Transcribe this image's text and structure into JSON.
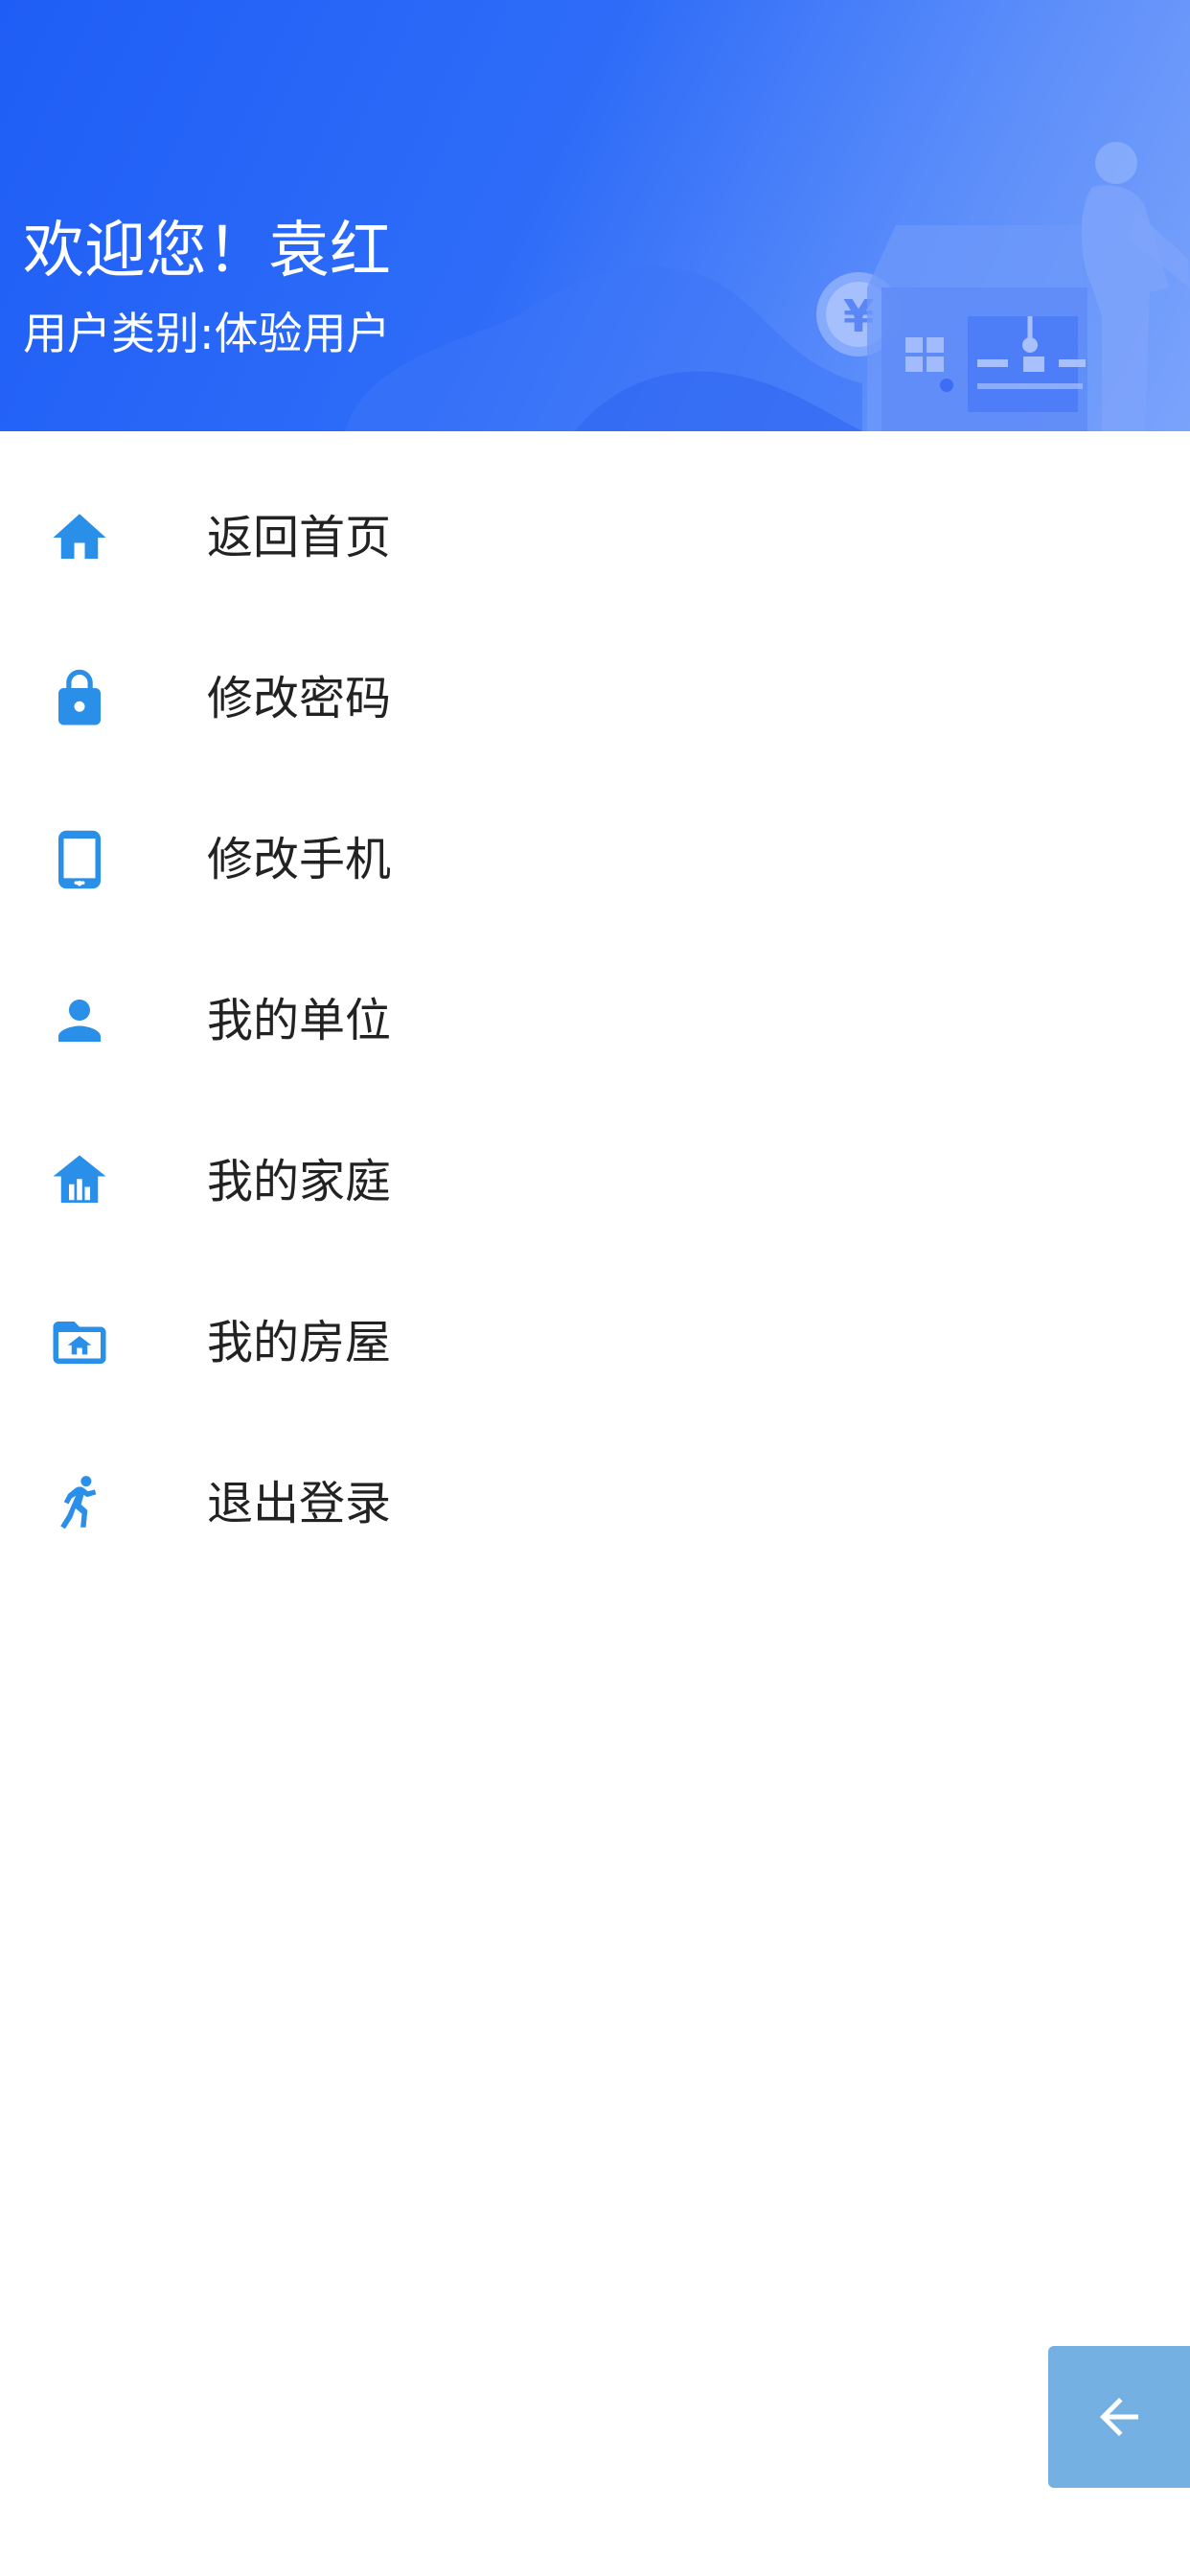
{
  "header": {
    "welcome": "欢迎您！袁红",
    "user_type": "用户类别:体验用户",
    "currency_symbol": "¥"
  },
  "menu": {
    "items": [
      {
        "label": "返回首页",
        "icon": "home-icon"
      },
      {
        "label": "修改密码",
        "icon": "lock-icon"
      },
      {
        "label": "修改手机",
        "icon": "tablet-icon"
      },
      {
        "label": "我的单位",
        "icon": "person-icon"
      },
      {
        "label": "我的家庭",
        "icon": "bank-icon"
      },
      {
        "label": "我的房屋",
        "icon": "folder-home-icon"
      },
      {
        "label": "退出登录",
        "icon": "runner-icon"
      }
    ]
  },
  "back_button": {
    "icon": "arrow-left-icon"
  },
  "colors": {
    "accent": "#2a8fe8",
    "header_start": "#1f5ef6",
    "header_end": "#7aa3fb",
    "back_button": "#74b0e2",
    "text": "#222222"
  }
}
